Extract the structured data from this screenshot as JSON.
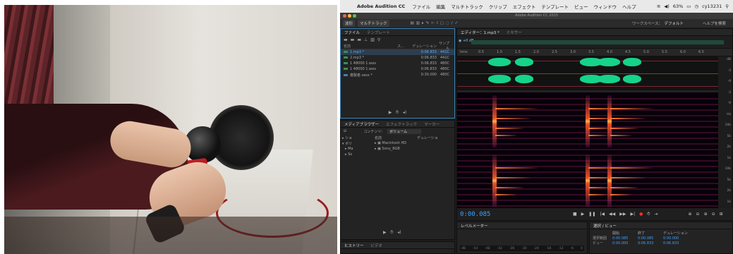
{
  "menubar": {
    "app": "Adobe Audition CC",
    "items": [
      "ファイル",
      "編集",
      "マルチトラック",
      "クリップ",
      "エフェクト",
      "テンプレート",
      "ビュー",
      "ウィンドウ",
      "ヘルプ"
    ],
    "battery": "63%",
    "user": "cy13231"
  },
  "window_title": "Adobe Audition CC 2015",
  "toolbar": {
    "waveform_label": "波形",
    "multitrack_label": "マルチトラック",
    "workspace_label": "ワークスペース：",
    "workspace_value": "デフォルト",
    "help_search": "ヘルプを検索"
  },
  "files_panel": {
    "tab_files": "ファイル",
    "tab_template": "テンプレート",
    "columns": [
      "名前",
      "ス...",
      "デュレーション",
      "サンプル"
    ],
    "rows": [
      {
        "name": "1.mp3 *",
        "duration": "0:06.833",
        "rate": "441C"
      },
      {
        "name": "2.mp3 *",
        "duration": "0:06.833",
        "rate": "441C"
      },
      {
        "name": "1 48000 1.wav",
        "duration": "0:06.833",
        "rate": "480C"
      },
      {
        "name": "1 48000 1.wav",
        "duration": "0:06.833",
        "rate": "480C"
      },
      {
        "name": "複製者.sesx *",
        "duration": "0:30.000",
        "rate": "480C"
      }
    ]
  },
  "media_panel": {
    "tab_media": "メディアブラウザー",
    "tab_effects": "エフェクトラック",
    "tab_markers": "マーカー",
    "content_label": "コンテンツ：",
    "content_value": "ボリューム",
    "col_name": "名前",
    "col_duration": "デュレーショ",
    "tree_left": [
      "ショ",
      "ボリ",
      "Ma",
      "So"
    ],
    "items": [
      "Macintosh HD",
      "Sony_8GB"
    ]
  },
  "history_panel": {
    "tab_history": "ヒストリー",
    "tab_video": "ビデオ"
  },
  "editor": {
    "tab_editor": "エディター：1.mp3 *",
    "tab_mixer": "ミキサー",
    "volume": "+0 dB",
    "ruler": [
      "hms",
      "0.5",
      "1.0",
      "1.5",
      "2.0",
      "2.5",
      "3.0",
      "3.5",
      "4.0",
      "4.5",
      "5.0",
      "5.5",
      "6.0",
      "6.5"
    ],
    "db_scale": [
      "dB",
      "-3",
      "-9",
      "-3",
      "-9",
      "Hz",
      "10k",
      "5k",
      "2k",
      "1k",
      "10k",
      "5k",
      "2k",
      "1k"
    ],
    "current_time": "0:00.085"
  },
  "level_panel": {
    "title": "レベルメーター",
    "scale": [
      "dB",
      "-54",
      "-48",
      "-42",
      "-36",
      "-30",
      "-24",
      "-18",
      "-12",
      "-6",
      "0"
    ]
  },
  "selection_panel": {
    "title": "選択 / ビュー",
    "headers": [
      "開始",
      "終了",
      "デュレーション"
    ],
    "rows": [
      {
        "label": "選択範囲",
        "start": "0:00.085",
        "end": "0:00.085",
        "duration": "0:00.000"
      },
      {
        "label": "ビュー",
        "start": "0:00.000",
        "end": "0:06.833",
        "duration": "0:06.833"
      }
    ]
  },
  "colors": {
    "waveform": "#16d38a",
    "accent": "#3aa0ff",
    "spectrogram_hot": "#ffb347"
  }
}
